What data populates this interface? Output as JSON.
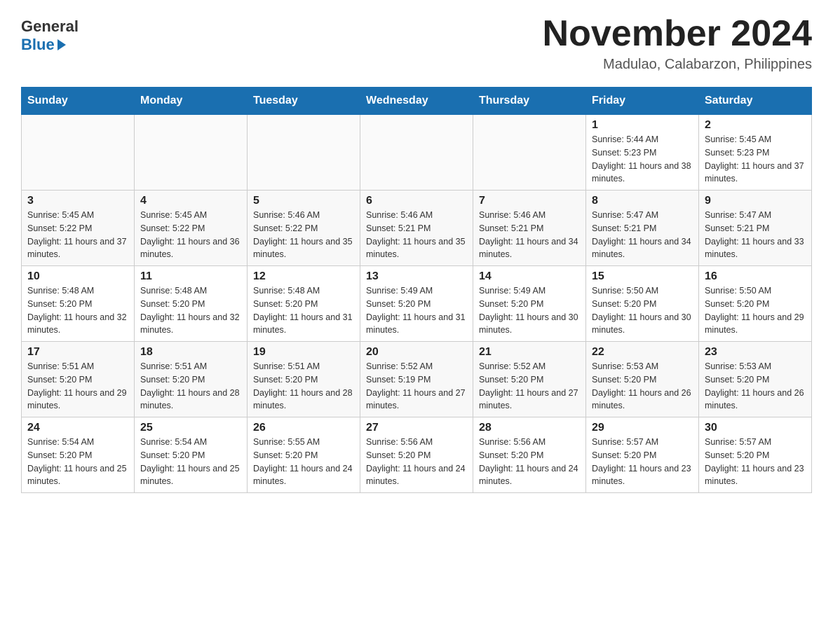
{
  "header": {
    "logo_general": "General",
    "logo_blue": "Blue",
    "month_year": "November 2024",
    "location": "Madulao, Calabarzon, Philippines"
  },
  "calendar": {
    "days_of_week": [
      "Sunday",
      "Monday",
      "Tuesday",
      "Wednesday",
      "Thursday",
      "Friday",
      "Saturday"
    ],
    "weeks": [
      [
        {
          "day": "",
          "info": ""
        },
        {
          "day": "",
          "info": ""
        },
        {
          "day": "",
          "info": ""
        },
        {
          "day": "",
          "info": ""
        },
        {
          "day": "",
          "info": ""
        },
        {
          "day": "1",
          "info": "Sunrise: 5:44 AM\nSunset: 5:23 PM\nDaylight: 11 hours and 38 minutes."
        },
        {
          "day": "2",
          "info": "Sunrise: 5:45 AM\nSunset: 5:23 PM\nDaylight: 11 hours and 37 minutes."
        }
      ],
      [
        {
          "day": "3",
          "info": "Sunrise: 5:45 AM\nSunset: 5:22 PM\nDaylight: 11 hours and 37 minutes."
        },
        {
          "day": "4",
          "info": "Sunrise: 5:45 AM\nSunset: 5:22 PM\nDaylight: 11 hours and 36 minutes."
        },
        {
          "day": "5",
          "info": "Sunrise: 5:46 AM\nSunset: 5:22 PM\nDaylight: 11 hours and 35 minutes."
        },
        {
          "day": "6",
          "info": "Sunrise: 5:46 AM\nSunset: 5:21 PM\nDaylight: 11 hours and 35 minutes."
        },
        {
          "day": "7",
          "info": "Sunrise: 5:46 AM\nSunset: 5:21 PM\nDaylight: 11 hours and 34 minutes."
        },
        {
          "day": "8",
          "info": "Sunrise: 5:47 AM\nSunset: 5:21 PM\nDaylight: 11 hours and 34 minutes."
        },
        {
          "day": "9",
          "info": "Sunrise: 5:47 AM\nSunset: 5:21 PM\nDaylight: 11 hours and 33 minutes."
        }
      ],
      [
        {
          "day": "10",
          "info": "Sunrise: 5:48 AM\nSunset: 5:20 PM\nDaylight: 11 hours and 32 minutes."
        },
        {
          "day": "11",
          "info": "Sunrise: 5:48 AM\nSunset: 5:20 PM\nDaylight: 11 hours and 32 minutes."
        },
        {
          "day": "12",
          "info": "Sunrise: 5:48 AM\nSunset: 5:20 PM\nDaylight: 11 hours and 31 minutes."
        },
        {
          "day": "13",
          "info": "Sunrise: 5:49 AM\nSunset: 5:20 PM\nDaylight: 11 hours and 31 minutes."
        },
        {
          "day": "14",
          "info": "Sunrise: 5:49 AM\nSunset: 5:20 PM\nDaylight: 11 hours and 30 minutes."
        },
        {
          "day": "15",
          "info": "Sunrise: 5:50 AM\nSunset: 5:20 PM\nDaylight: 11 hours and 30 minutes."
        },
        {
          "day": "16",
          "info": "Sunrise: 5:50 AM\nSunset: 5:20 PM\nDaylight: 11 hours and 29 minutes."
        }
      ],
      [
        {
          "day": "17",
          "info": "Sunrise: 5:51 AM\nSunset: 5:20 PM\nDaylight: 11 hours and 29 minutes."
        },
        {
          "day": "18",
          "info": "Sunrise: 5:51 AM\nSunset: 5:20 PM\nDaylight: 11 hours and 28 minutes."
        },
        {
          "day": "19",
          "info": "Sunrise: 5:51 AM\nSunset: 5:20 PM\nDaylight: 11 hours and 28 minutes."
        },
        {
          "day": "20",
          "info": "Sunrise: 5:52 AM\nSunset: 5:19 PM\nDaylight: 11 hours and 27 minutes."
        },
        {
          "day": "21",
          "info": "Sunrise: 5:52 AM\nSunset: 5:20 PM\nDaylight: 11 hours and 27 minutes."
        },
        {
          "day": "22",
          "info": "Sunrise: 5:53 AM\nSunset: 5:20 PM\nDaylight: 11 hours and 26 minutes."
        },
        {
          "day": "23",
          "info": "Sunrise: 5:53 AM\nSunset: 5:20 PM\nDaylight: 11 hours and 26 minutes."
        }
      ],
      [
        {
          "day": "24",
          "info": "Sunrise: 5:54 AM\nSunset: 5:20 PM\nDaylight: 11 hours and 25 minutes."
        },
        {
          "day": "25",
          "info": "Sunrise: 5:54 AM\nSunset: 5:20 PM\nDaylight: 11 hours and 25 minutes."
        },
        {
          "day": "26",
          "info": "Sunrise: 5:55 AM\nSunset: 5:20 PM\nDaylight: 11 hours and 24 minutes."
        },
        {
          "day": "27",
          "info": "Sunrise: 5:56 AM\nSunset: 5:20 PM\nDaylight: 11 hours and 24 minutes."
        },
        {
          "day": "28",
          "info": "Sunrise: 5:56 AM\nSunset: 5:20 PM\nDaylight: 11 hours and 24 minutes."
        },
        {
          "day": "29",
          "info": "Sunrise: 5:57 AM\nSunset: 5:20 PM\nDaylight: 11 hours and 23 minutes."
        },
        {
          "day": "30",
          "info": "Sunrise: 5:57 AM\nSunset: 5:20 PM\nDaylight: 11 hours and 23 minutes."
        }
      ]
    ]
  }
}
